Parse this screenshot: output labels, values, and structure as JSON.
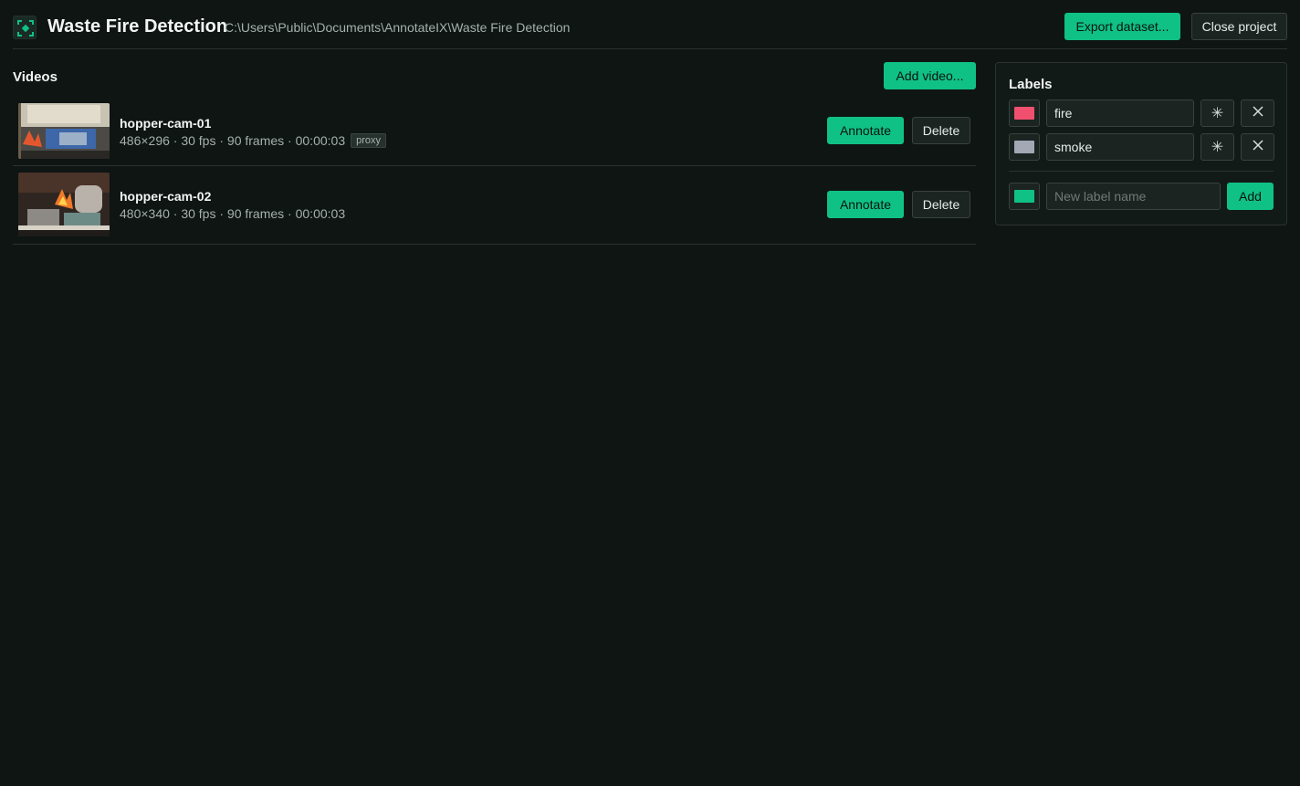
{
  "header": {
    "title": "Waste Fire Detection",
    "path": "C:\\Users\\Public\\Documents\\AnnotateIX\\Waste Fire Detection",
    "export_label": "Export dataset...",
    "close_label": "Close project"
  },
  "videos": {
    "title": "Videos",
    "add_label": "Add video...",
    "items": [
      {
        "name": "hopper-cam-01",
        "meta": "486×296 · 30 fps · 90 frames · 00:00:03",
        "badge": "proxy",
        "annotate_label": "Annotate",
        "delete_label": "Delete"
      },
      {
        "name": "hopper-cam-02",
        "meta": "480×340 · 30 fps · 90 frames · 00:00:03",
        "annotate_label": "Annotate",
        "delete_label": "Delete"
      }
    ]
  },
  "labels": {
    "title": "Labels",
    "items": [
      {
        "name": "fire",
        "color": "#f0506e"
      },
      {
        "name": "smoke",
        "color": "#a3a8b4"
      }
    ],
    "new_label": {
      "color": "#10c185",
      "placeholder": "New label name",
      "add_label": "Add"
    }
  },
  "colors": {
    "background": "#0e1513",
    "accent": "#10c185",
    "panel": "#121a18"
  },
  "icons": {
    "logo": "focus-frame-icon",
    "color_picker": "asterisk-icon",
    "remove": "close-icon"
  }
}
